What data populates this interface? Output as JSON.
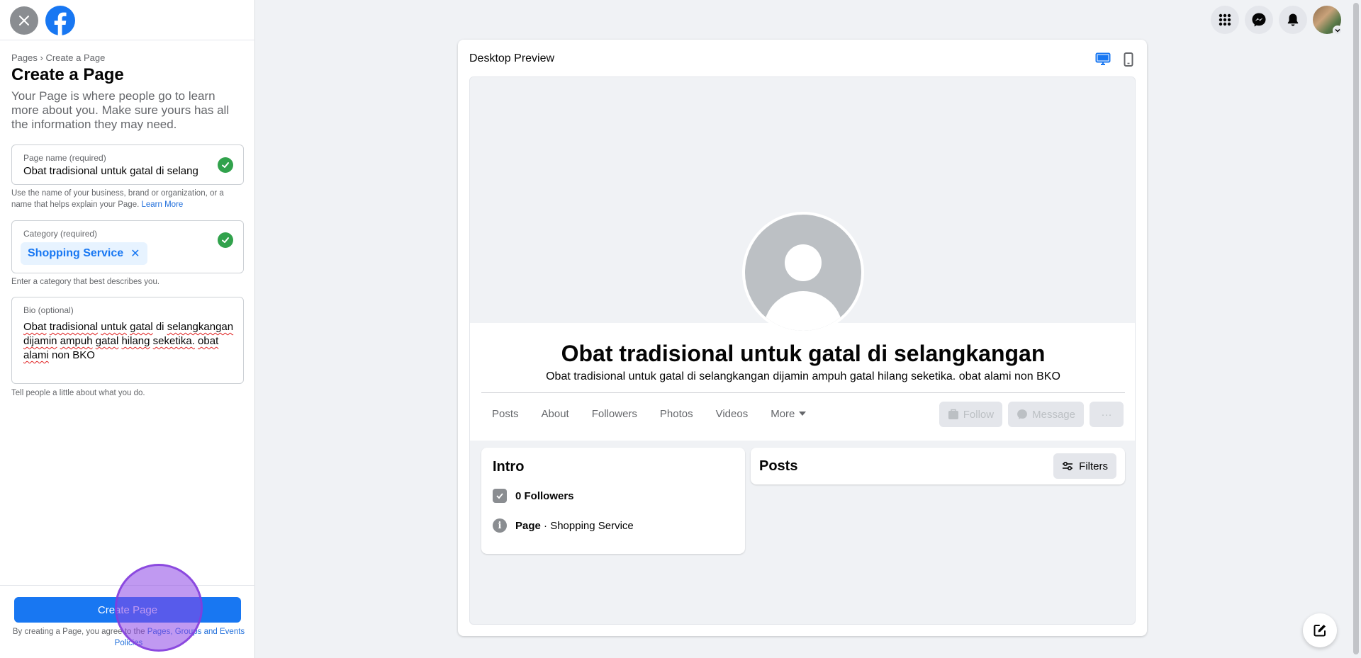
{
  "left_panel": {
    "breadcrumb": {
      "pages": "Pages",
      "separator": "›",
      "current": "Create a Page"
    },
    "title": "Create a Page",
    "intro": "Your Page is where people go to learn more about you. Make sure yours has all the information they may need.",
    "page_name": {
      "label": "Page name (required)",
      "value": "Obat tradisional untuk gatal di selang",
      "helper": "Use the name of your business, brand or organization, or a name that helps explain your Page.",
      "helper_link": "Learn More"
    },
    "category": {
      "label": "Category (required)",
      "chip": "Shopping Service",
      "helper": "Enter a category that best describes you."
    },
    "bio": {
      "label": "Bio (optional)",
      "words": [
        "Obat",
        "tradisional",
        "untuk",
        "gatal",
        "di",
        "selangkangan",
        "dijamin",
        "ampuh",
        "gatal",
        "hilang",
        "seketika.",
        "obat",
        "alami",
        "non",
        "BKO"
      ],
      "helper": "Tell people a little about what you do."
    },
    "create_button": "Create Page",
    "footer_note": {
      "text": "By creating a Page, you agree to the",
      "link": "Pages, Groups and Events Policies"
    }
  },
  "preview": {
    "title": "Desktop Preview",
    "page_name": "Obat tradisional untuk gatal di selangkangan",
    "bio": "Obat tradisional untuk gatal di selangkangan dijamin ampuh gatal hilang seketika. obat alami non BKO",
    "tabs": [
      "Posts",
      "About",
      "Followers",
      "Photos",
      "Videos",
      "More"
    ],
    "actions": {
      "follow": "Follow",
      "message": "Message",
      "more": "···"
    },
    "intro": {
      "title": "Intro",
      "followers": "0 Followers",
      "page_label": "Page",
      "separator": "·",
      "category": "Shopping Service"
    },
    "posts": {
      "title": "Posts",
      "filters": "Filters"
    }
  },
  "colors": {
    "brand": "#1877f2",
    "check": "#31a24c",
    "click_indicator": "#8c46e6"
  }
}
